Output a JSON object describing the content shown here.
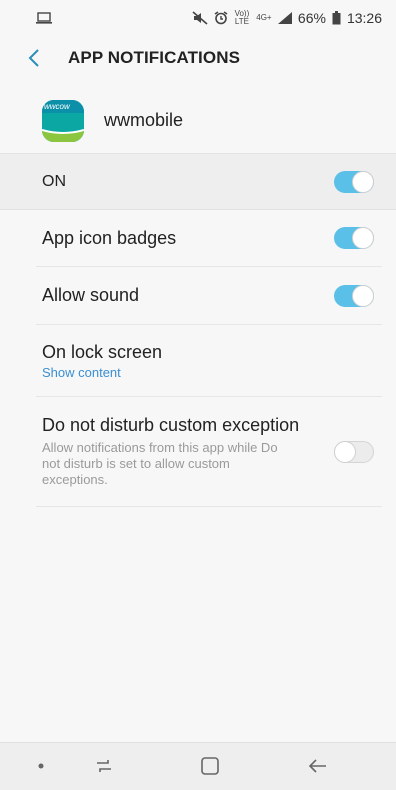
{
  "status_bar": {
    "left_icon": "laptop-icon",
    "icons": [
      "mute-icon",
      "alarm-icon",
      "volte-icon",
      "4g-icon",
      "signal-icon"
    ],
    "volte_text": "Vo)) LTE",
    "network_text": "4G+",
    "battery_percent": "66%",
    "time": "13:26"
  },
  "header": {
    "back_icon": "chevron-left-icon",
    "title": "APP NOTIFICATIONS"
  },
  "app": {
    "name": "wwmobile",
    "icon_text": "wwcow"
  },
  "main_toggle": {
    "label": "ON",
    "state": true
  },
  "settings": [
    {
      "title": "App icon badges",
      "state": true
    },
    {
      "title": "Allow sound",
      "state": true
    },
    {
      "title": "On lock screen",
      "subtitle": "Show content"
    },
    {
      "title": "Do not disturb custom exception",
      "description": "Allow notifications from this app while Do not disturb is set to allow custom exceptions.",
      "state": false
    }
  ],
  "nav_bar": {
    "icons": [
      "dot-icon",
      "recent-apps-icon",
      "home-icon",
      "back-arrow-icon"
    ]
  },
  "colors": {
    "toggle_on": "#5bc0e8",
    "accent_blue": "#3a8fd1",
    "app_icon": "#0aa7a3"
  }
}
